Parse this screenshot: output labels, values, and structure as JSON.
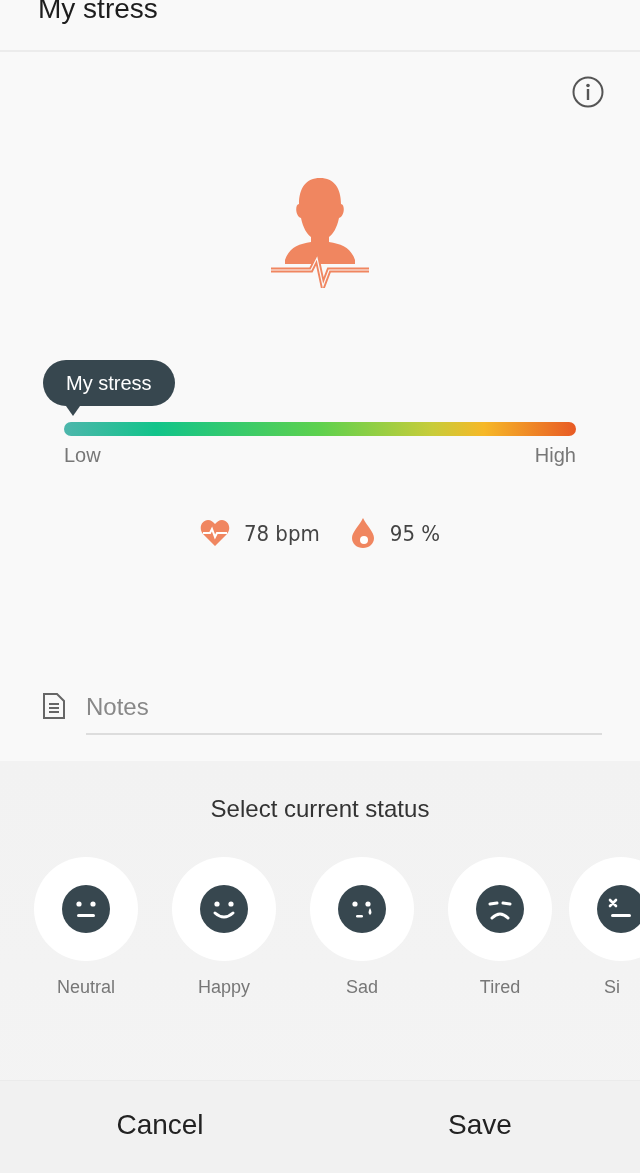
{
  "header": {
    "title": "My stress"
  },
  "stress": {
    "marker_label": "My stress",
    "low_label": "Low",
    "high_label": "High"
  },
  "vitals": [
    {
      "kind": "heart",
      "value": "78 bpm"
    },
    {
      "kind": "oxygen",
      "value": "95 %"
    }
  ],
  "notes": {
    "placeholder": "Notes"
  },
  "status": {
    "title": "Select current status",
    "options": [
      {
        "kind": "neutral",
        "label": "Neutral"
      },
      {
        "kind": "happy",
        "label": "Happy"
      },
      {
        "kind": "sad",
        "label": "Sad"
      },
      {
        "kind": "tired",
        "label": "Tired"
      },
      {
        "kind": "sick",
        "label": "Si"
      }
    ]
  },
  "buttons": [
    "Cancel",
    "Save"
  ]
}
